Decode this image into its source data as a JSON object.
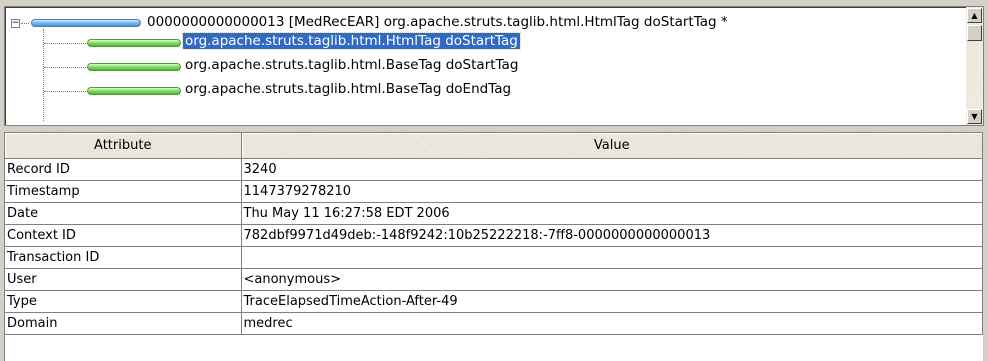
{
  "tree": {
    "root": {
      "label": "0000000000000013 [MedRecEAR] org.apache.struts.taglib.html.HtmlTag doStartTag *",
      "expander": "−"
    },
    "children": [
      {
        "label": "org.apache.struts.taglib.html.HtmlTag  doStartTag",
        "selected": true
      },
      {
        "label": "org.apache.struts.taglib.html.BaseTag  doStartTag",
        "selected": false
      },
      {
        "label": "org.apache.struts.taglib.html.BaseTag  doEndTag",
        "selected": false
      }
    ],
    "scroll_up": "▲",
    "scroll_down": "▼"
  },
  "table": {
    "headers": [
      "Attribute",
      "Value"
    ],
    "rows": [
      [
        "Record ID",
        "3240"
      ],
      [
        "Timestamp",
        "1147379278210"
      ],
      [
        "Date",
        "Thu May 11 16:27:58 EDT 2006"
      ],
      [
        "Context ID",
        "782dbf9971d49deb:-148f9242:10b25222218:-7ff8-0000000000000013"
      ],
      [
        "Transaction ID",
        ""
      ],
      [
        "User",
        "<anonymous>"
      ],
      [
        "Type",
        "TraceElapsedTimeAction-After-49"
      ],
      [
        "Domain",
        "medrec"
      ]
    ]
  }
}
